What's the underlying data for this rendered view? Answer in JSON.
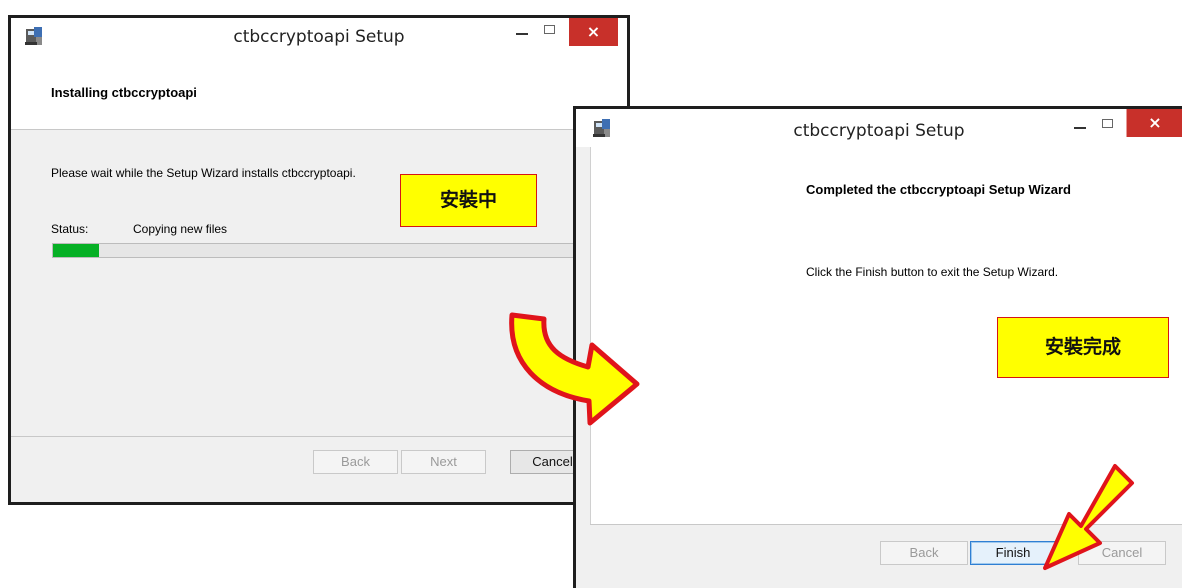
{
  "installing_window": {
    "title": "ctbccryptoapi Setup",
    "close_glyph": "×",
    "heading": "Installing ctbccryptoapi",
    "message": "Please wait while the Setup Wizard installs ctbccryptoapi.",
    "status_label": "Status:",
    "status_value": "Copying new files",
    "progress_fraction": 0.08,
    "buttons": {
      "back": "Back",
      "next": "Next",
      "cancel": "Cancel"
    }
  },
  "completed_window": {
    "title": "ctbccryptoapi Setup",
    "close_glyph": "×",
    "heading": "Completed the ctbccryptoapi Setup Wizard",
    "message": "Click the Finish button to exit the Setup Wizard.",
    "buttons": {
      "back": "Back",
      "finish": "Finish",
      "cancel": "Cancel"
    }
  },
  "annotations": {
    "installing_label": "安裝中",
    "completed_label": "安裝完成",
    "label_bg": "#ffff00",
    "label_border": "#d51515"
  },
  "colors": {
    "progress_fill": "#06b025",
    "close_button": "#c8302a"
  }
}
